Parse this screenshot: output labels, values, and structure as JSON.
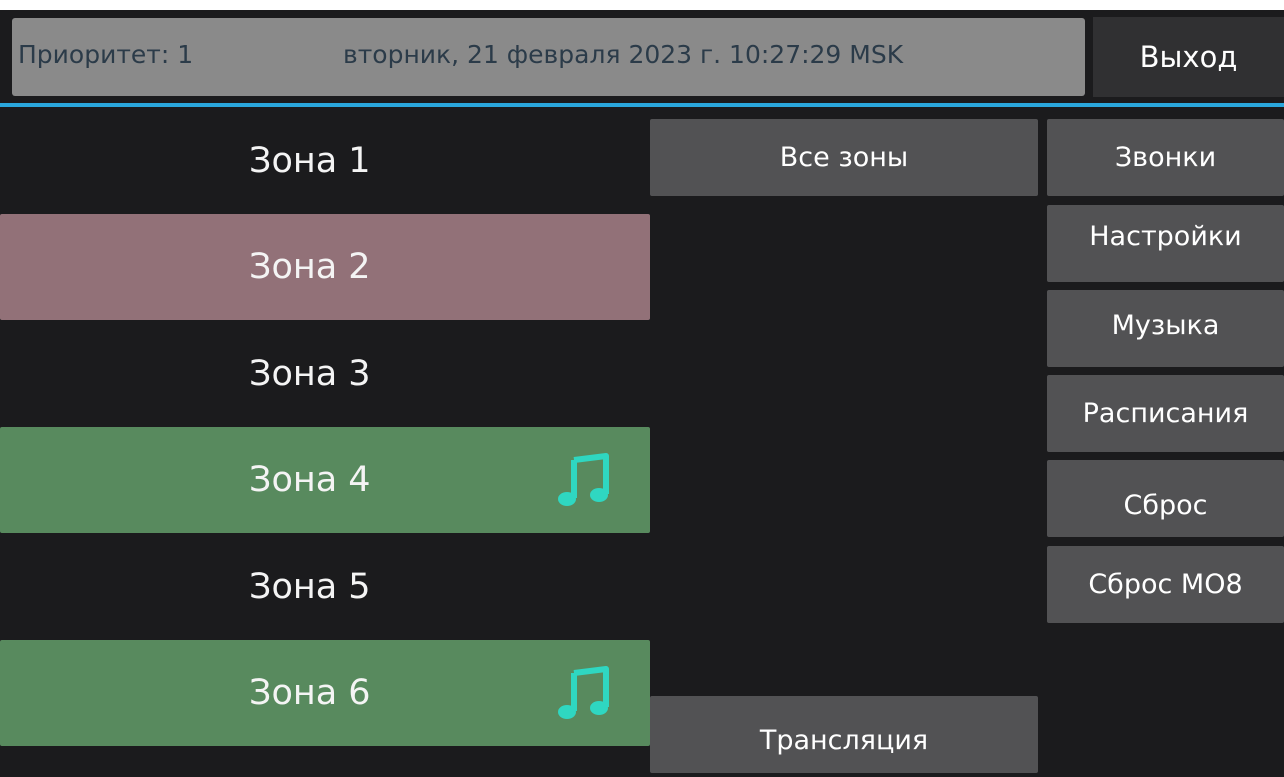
{
  "header": {
    "priority": "Приоритет: 1",
    "datetime": "вторник, 21 февраля 2023 г. 10:27:29 MSK",
    "exit_label": "Выход"
  },
  "zones": [
    {
      "label": "Зона 1",
      "state": "normal",
      "music": false
    },
    {
      "label": "Зона 2",
      "state": "alert",
      "music": false
    },
    {
      "label": "Зона 3",
      "state": "normal",
      "music": false
    },
    {
      "label": "Зона 4",
      "state": "music",
      "music": true
    },
    {
      "label": "Зона 5",
      "state": "normal",
      "music": false
    },
    {
      "label": "Зона 6",
      "state": "music",
      "music": true
    }
  ],
  "center": {
    "all_zones_label": "Все зоны",
    "broadcast_label": "Трансляция"
  },
  "menu": {
    "calls": "Звонки",
    "settings": "Настройки",
    "music": "Музыка",
    "schedules": "Расписания",
    "reset": "Сброс",
    "reset_mo8": "Сброс МО8"
  },
  "icons": {
    "music_note": "music-note-icon"
  },
  "colors": {
    "background": "#1b1b1d",
    "status_bar": "#8a8a8a",
    "divider": "#2aa7dd",
    "zone_alert": "#927178",
    "zone_music": "#588a5e",
    "button": "#525254",
    "note_icon": "#2fd7c1"
  }
}
